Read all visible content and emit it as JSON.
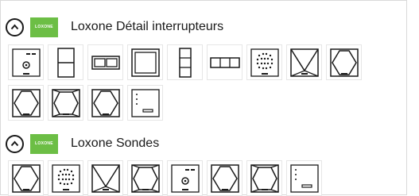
{
  "groups": [
    {
      "title": "Loxone Détail interrupteurs",
      "logo_text": "LOXONE",
      "rows": [
        [
          "presence-sensor-icon",
          "switch-2-vertical-icon",
          "switch-2-horizontal-icon",
          "switch-1-square-icon",
          "switch-3-vertical-icon",
          "switch-3-horizontal-icon",
          "dot-grid-icon",
          "touch-corners-x-icon",
          "touch-hex-icon"
        ],
        [
          "touch-hex-icon",
          "touch-hex-full-icon",
          "touch-hex-icon",
          "touch-surface-icon"
        ]
      ]
    },
    {
      "title": "Loxone Sondes",
      "logo_text": "LOXONE",
      "rows": [
        [
          "touch-hex-icon",
          "dot-grid-icon",
          "touch-corners-x-icon",
          "touch-hex-full-icon",
          "presence-sensor-icon",
          "touch-hex-icon",
          "touch-hex-full-icon",
          "touch-surface-icon"
        ]
      ]
    }
  ],
  "colors": {
    "logo_green": "#6cbe45",
    "stroke": "#1a1a1a"
  }
}
